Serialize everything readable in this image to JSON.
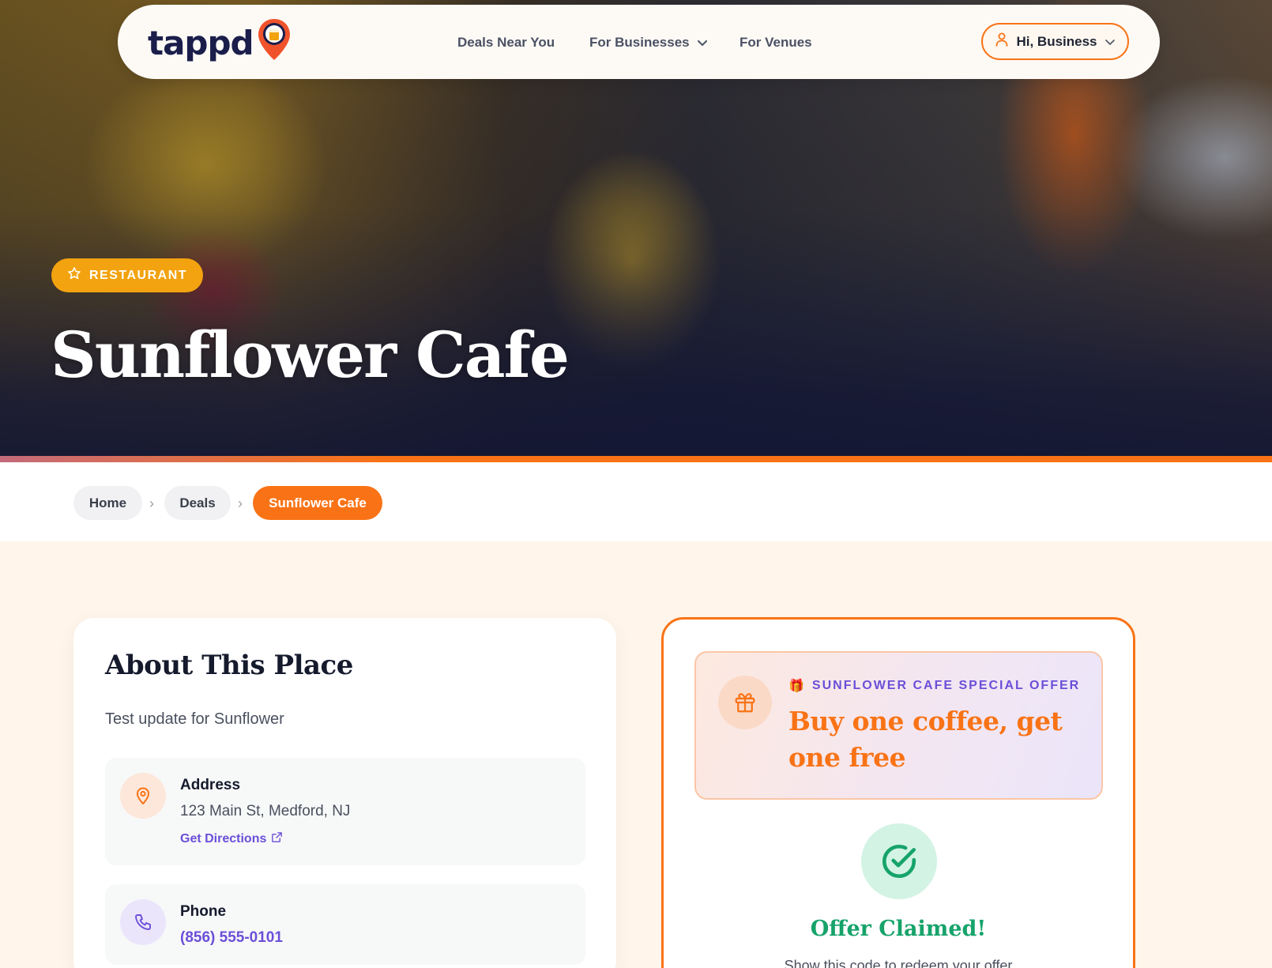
{
  "header": {
    "logo_text": "tappd",
    "nav": {
      "deals_near_you": "Deals Near You",
      "for_businesses": "For Businesses",
      "for_venues": "For Venues"
    },
    "user_menu_label": "Hi, Business"
  },
  "hero": {
    "category_badge": "RESTAURANT",
    "title": "Sunflower Cafe"
  },
  "breadcrumb": {
    "home": "Home",
    "deals": "Deals",
    "current": "Sunflower Cafe",
    "separator": "›"
  },
  "about": {
    "title": "About This Place",
    "description": "Test update for Sunflower",
    "address": {
      "label": "Address",
      "value": "123 Main St, Medford, NJ",
      "link": "Get Directions"
    },
    "phone": {
      "label": "Phone",
      "value": "(856) 555-0101"
    }
  },
  "offer": {
    "kicker": "SUNFLOWER CAFE SPECIAL OFFER",
    "kicker_emoji": "🎁",
    "headline": "Buy one coffee, get one free",
    "status_title": "Offer Claimed!",
    "status_subtitle": "Show this code to redeem your offer"
  },
  "colors": {
    "accent_orange": "#f97316",
    "accent_purple": "#6b4fd8",
    "success_green": "#16a36a",
    "badge_amber": "#f2a30f",
    "navy": "#1b1e4b"
  },
  "icons": {
    "logo_pin": "map-pin-beer-icon",
    "nav_dropdown": "chevron-down-icon",
    "user": "user-icon",
    "badge": "star-icon",
    "address": "map-pin-icon",
    "external_link": "external-link-icon",
    "phone": "phone-icon",
    "gift": "gift-icon",
    "claimed": "check-circle-icon"
  }
}
